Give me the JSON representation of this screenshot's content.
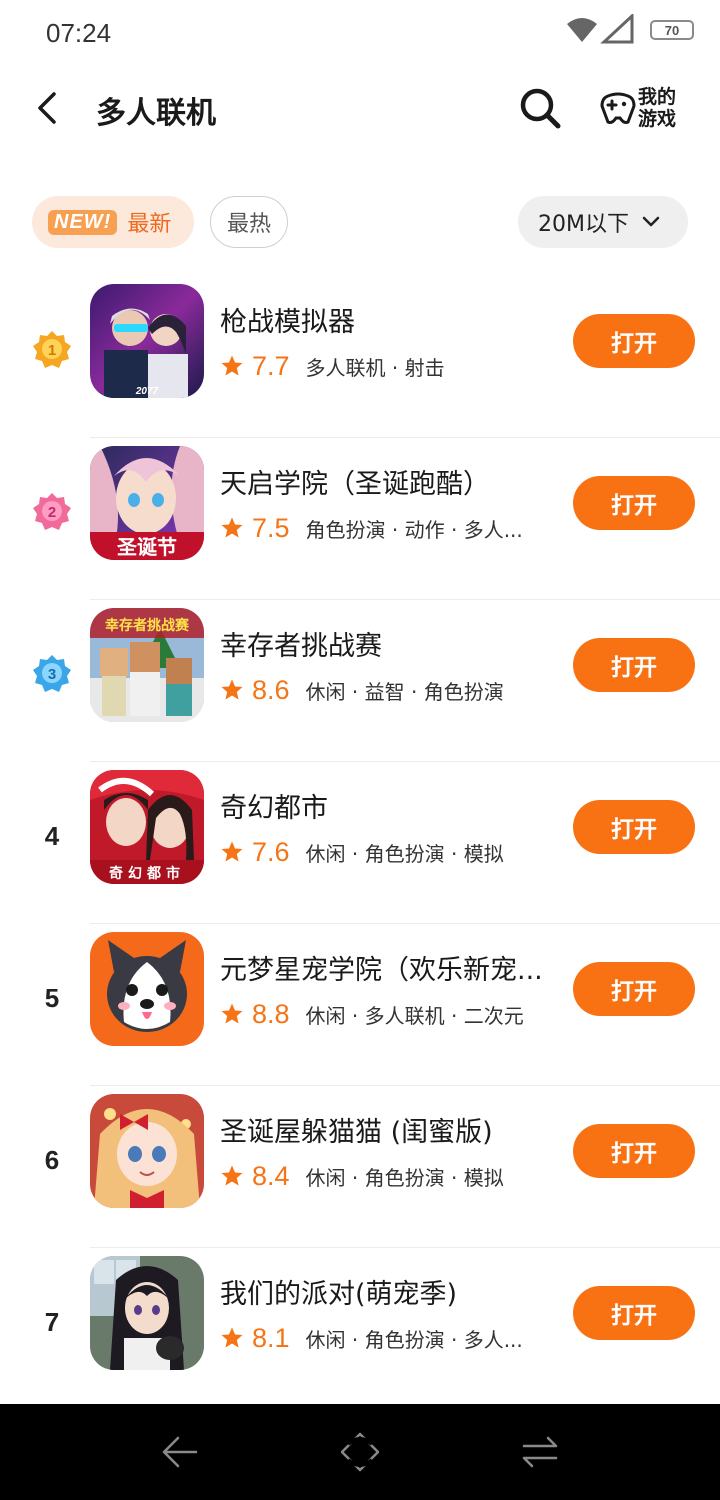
{
  "status_bar": {
    "time": "07:24",
    "battery": "70"
  },
  "header": {
    "title": "多人联机",
    "my_games_label": "我的游戏"
  },
  "filters": {
    "new_badge": "NEW!",
    "new_label": "最新",
    "hot_label": "最热",
    "size_label": "20M以下"
  },
  "open_label": "打开",
  "games": [
    {
      "rank": "1",
      "name": "枪战模拟器",
      "score": "7.7",
      "tags": "多人联机 · 射击"
    },
    {
      "rank": "2",
      "name": "天启学院（圣诞跑酷）",
      "score": "7.5",
      "tags": "角色扮演 · 动作 · 多人..."
    },
    {
      "rank": "3",
      "name": "幸存者挑战赛",
      "score": "8.6",
      "tags": "休闲 · 益智 · 角色扮演"
    },
    {
      "rank": "4",
      "name": "奇幻都市",
      "score": "7.6",
      "tags": "休闲 · 角色扮演 · 模拟"
    },
    {
      "rank": "5",
      "name": "元梦星宠学院（欢乐新宠...",
      "score": "8.8",
      "tags": "休闲 · 多人联机 · 二次元"
    },
    {
      "rank": "6",
      "name": "圣诞屋躲猫猫 (闺蜜版)",
      "score": "8.4",
      "tags": "休闲 · 角色扮演 · 模拟"
    },
    {
      "rank": "7",
      "name": "我们的派对(萌宠季)",
      "score": "8.1",
      "tags": "休闲 · 角色扮演 · 多人..."
    }
  ],
  "icon_captions": {
    "game2": "圣诞节",
    "game3": "幸存者挑战赛",
    "game4": "奇幻都市",
    "game1": "2077"
  },
  "colors": {
    "accent": "#f87113",
    "score": "#f57416",
    "chip_bg": "#fde8dc"
  }
}
